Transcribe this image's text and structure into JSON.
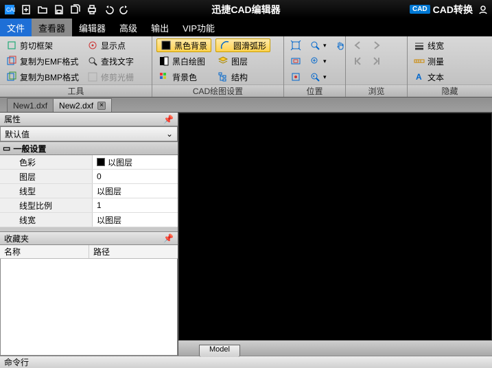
{
  "app": {
    "title": "迅捷CAD编辑器"
  },
  "titlebar": {
    "cad_badge": "CAD",
    "cad_convert": "CAD转换"
  },
  "menu": {
    "file": "文件",
    "viewer": "查看器",
    "editor": "编辑器",
    "advanced": "高级",
    "output": "输出",
    "vip": "VIP功能"
  },
  "ribbon": {
    "tools": {
      "caption": "工具",
      "cut_frame": "剪切框架",
      "copy_emf": "复制为EMF格式",
      "copy_bmp": "复制为BMP格式",
      "show_point": "显示点",
      "find_text": "查找文字",
      "trim_raster": "修剪光栅"
    },
    "cadset": {
      "caption": "CAD绘图设置",
      "black_bg": "黑色背景",
      "bw_draw": "黑白绘图",
      "bg_color": "背景色",
      "smooth_arc": "圆滑弧形",
      "layer": "图层",
      "structure": "结构"
    },
    "position": {
      "caption": "位置"
    },
    "browse": {
      "caption": "浏览"
    },
    "hide": {
      "caption": "隐藏",
      "linewidth": "线宽",
      "measure": "测量",
      "text": "文本"
    }
  },
  "doctabs": {
    "tab1": "New1.dxf",
    "tab2": "New2.dxf"
  },
  "properties": {
    "title": "属性",
    "combo": "默认值",
    "section": "一般设置",
    "rows": {
      "color": {
        "k": "色彩",
        "v": "以图层"
      },
      "layer": {
        "k": "图层",
        "v": "0"
      },
      "ltype": {
        "k": "线型",
        "v": "以图层"
      },
      "lscale": {
        "k": "线型比例",
        "v": "1"
      },
      "lwidth": {
        "k": "线宽",
        "v": "以图层"
      }
    }
  },
  "favorites": {
    "title": "收藏夹",
    "col_name": "名称",
    "col_path": "路径"
  },
  "model_tab": "Model",
  "cmdline": "命令行"
}
